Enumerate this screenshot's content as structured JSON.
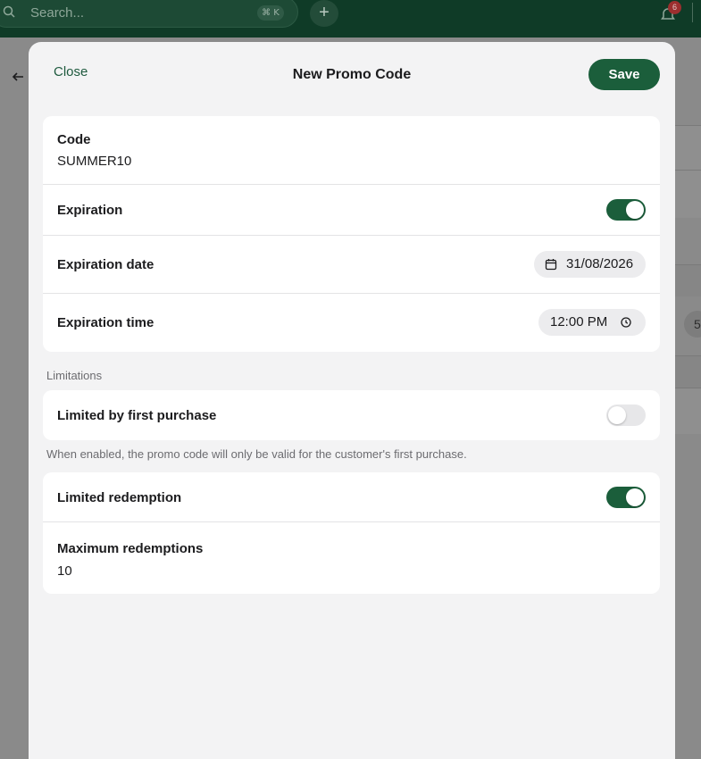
{
  "topbar": {
    "search_placeholder": "Search...",
    "shortcut": "⌘ K",
    "add_label": "+",
    "notification_count": "6"
  },
  "background": {
    "chip_text": "5"
  },
  "modal": {
    "close_label": "Close",
    "title": "New Promo Code",
    "save_label": "Save",
    "code": {
      "label": "Code",
      "value": "SUMMER10"
    },
    "expiration": {
      "label": "Expiration",
      "enabled": true
    },
    "expiration_date": {
      "label": "Expiration date",
      "value": "31/08/2026"
    },
    "expiration_time": {
      "label": "Expiration time",
      "value": "12:00 PM"
    },
    "limitations_heading": "Limitations",
    "first_purchase": {
      "label": "Limited by first purchase",
      "enabled": false,
      "helper": "When enabled, the promo code will only be valid for the customer's first purchase."
    },
    "limited_redemption": {
      "label": "Limited redemption",
      "enabled": true
    },
    "max_redemptions": {
      "label": "Maximum redemptions",
      "value": "10"
    }
  },
  "colors": {
    "brand_green": "#1b5e3b",
    "topbar_bg": "#0f3b27",
    "overlay_bg": "#8a8a8a"
  }
}
